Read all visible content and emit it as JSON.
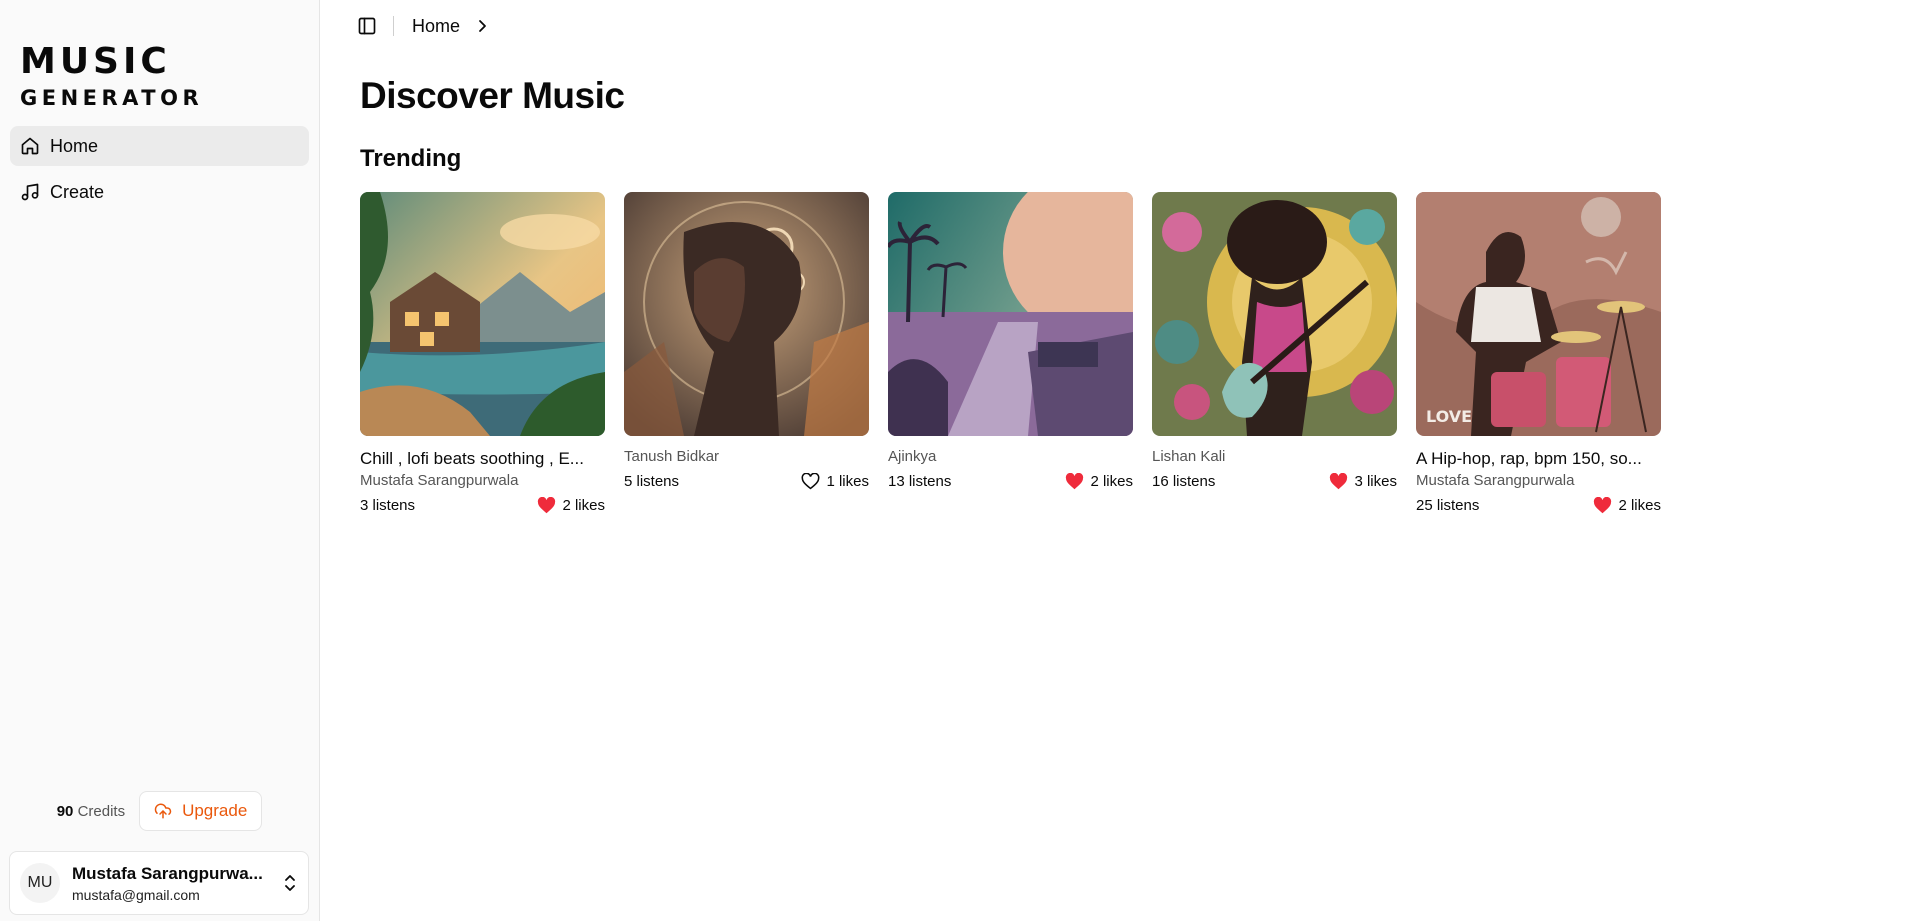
{
  "brand": {
    "line1": "MUSIC",
    "line2": "GENERATOR"
  },
  "sidebar": {
    "items": [
      {
        "label": "Home",
        "icon": "home-icon",
        "active": true
      },
      {
        "label": "Create",
        "icon": "music-note-icon",
        "active": false
      }
    ],
    "credits": {
      "count": "90",
      "label": "Credits"
    },
    "upgrade_label": "Upgrade",
    "user": {
      "initials": "MU",
      "name": "Mustafa Sarangpurwa...",
      "email": "mustafa@gmail.com"
    }
  },
  "header": {
    "breadcrumb": "Home"
  },
  "main": {
    "title": "Discover Music",
    "section": "Trending",
    "tracks": [
      {
        "title": "Chill , lofi beats soothing , E...",
        "artist": "Mustafa Sarangpurwala",
        "listens": "3 listens",
        "likes": "2 likes",
        "liked": true
      },
      {
        "title": "",
        "artist": "Tanush Bidkar",
        "listens": "5 listens",
        "likes": "1 likes",
        "liked": false
      },
      {
        "title": "",
        "artist": "Ajinkya",
        "listens": "13 listens",
        "likes": "2 likes",
        "liked": true
      },
      {
        "title": "",
        "artist": "Lishan Kali",
        "listens": "16 listens",
        "likes": "3 likes",
        "liked": true
      },
      {
        "title": "A Hip-hop, rap, bpm 150, so...",
        "artist": "Mustafa Sarangpurwala",
        "listens": "25 listens",
        "likes": "2 likes",
        "liked": true
      }
    ]
  },
  "colors": {
    "accent": "#ea580c",
    "heart": "#ef2b3b",
    "sidebar_bg": "#fafafa",
    "active_bg": "#ebebeb"
  }
}
